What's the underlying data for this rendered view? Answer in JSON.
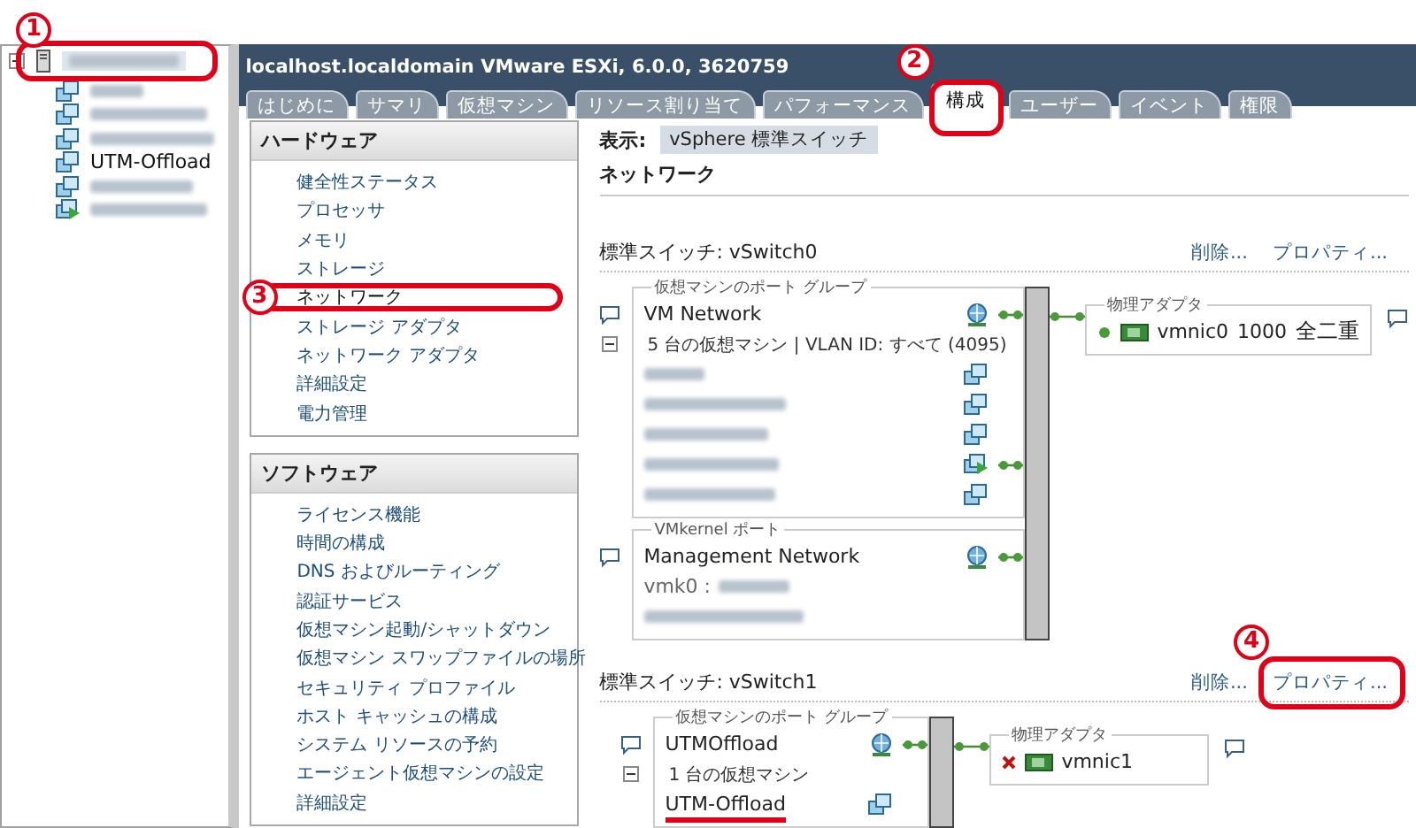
{
  "tree": {
    "host": {
      "expanded": true,
      "redacted": true,
      "step": "1"
    },
    "items": [
      {
        "kind": "vm",
        "redacted": true
      },
      {
        "kind": "vm",
        "redacted": true
      },
      {
        "kind": "vm",
        "redacted": true
      },
      {
        "kind": "vm",
        "redacted": false,
        "label": "UTM-Offload"
      },
      {
        "kind": "vm",
        "redacted": true
      },
      {
        "kind": "vm_on",
        "redacted": true
      }
    ]
  },
  "header": {
    "title": "localhost.localdomain VMware ESXi, 6.0.0, 3620759",
    "tabs": [
      {
        "label": "はじめに",
        "selected": false
      },
      {
        "label": "サマリ",
        "selected": false
      },
      {
        "label": "仮想マシン",
        "selected": false
      },
      {
        "label": "リソース割り当て",
        "selected": false
      },
      {
        "label": "パフォーマンス",
        "selected": false
      },
      {
        "label": "構成",
        "selected": true,
        "step": "2"
      },
      {
        "label": "ユーザー",
        "selected": false
      },
      {
        "label": "イベント",
        "selected": false
      },
      {
        "label": "権限",
        "selected": false
      }
    ]
  },
  "menu": [
    {
      "title": "ハードウェア",
      "items": [
        {
          "label": "健全性ステータス",
          "selected": false
        },
        {
          "label": "プロセッサ",
          "selected": false
        },
        {
          "label": "メモリ",
          "selected": false
        },
        {
          "label": "ストレージ",
          "selected": false
        },
        {
          "label": "ネットワーク",
          "selected": true,
          "step": "3"
        },
        {
          "label": "ストレージ アダプタ",
          "selected": false
        },
        {
          "label": "ネットワーク アダプタ",
          "selected": false
        },
        {
          "label": "詳細設定",
          "selected": false
        },
        {
          "label": "電力管理",
          "selected": false
        }
      ]
    },
    {
      "title": "ソフトウェア",
      "items": [
        {
          "label": "ライセンス機能",
          "selected": false
        },
        {
          "label": "時間の構成",
          "selected": false
        },
        {
          "label": "DNS およびルーティング",
          "selected": false
        },
        {
          "label": "認証サービス",
          "selected": false
        },
        {
          "label": "仮想マシン起動/シャットダウン",
          "selected": false
        },
        {
          "label": "仮想マシン スワップファイルの場所",
          "selected": false
        },
        {
          "label": "セキュリティ プロファイル",
          "selected": false
        },
        {
          "label": "ホスト キャッシュの構成",
          "selected": false
        },
        {
          "label": "システム リソースの予約",
          "selected": false
        },
        {
          "label": "エージェント仮想マシンの設定",
          "selected": false
        },
        {
          "label": "詳細設定",
          "selected": false
        }
      ]
    }
  ],
  "view": {
    "label": "表示:",
    "value": "vSphere 標準スイッチ"
  },
  "heading": "ネットワーク",
  "switches": [
    {
      "label": "標準スイッチ: vSwitch0",
      "actions": [
        {
          "label": "削除..."
        },
        {
          "label": "プロパティ..."
        }
      ],
      "groups": [
        {
          "kind": "vm_portgroup",
          "legend": "仮想マシンのポート グループ",
          "name": "VM Network",
          "summary": "5 台の仮想マシン | VLAN ID: すべて (4095)",
          "expanded": true,
          "vms": [
            {
              "kind": "vm",
              "redacted": true
            },
            {
              "kind": "vm",
              "redacted": true
            },
            {
              "kind": "vm",
              "redacted": true
            },
            {
              "kind": "vm_on",
              "redacted": true
            },
            {
              "kind": "vm",
              "redacted": true
            }
          ]
        },
        {
          "kind": "vmkernel",
          "legend": "VMkernel ポート",
          "name": "Management Network",
          "details": [
            {
              "label": "vmk0 :",
              "redacted": true
            },
            {
              "redacted": true
            }
          ]
        }
      ],
      "adapter": {
        "legend": "物理アダプタ",
        "name": "vmnic0",
        "speed": "1000",
        "duplex": "全二重",
        "connected": true
      }
    },
    {
      "label": "標準スイッチ: vSwitch1",
      "actions": [
        {
          "label": "削除..."
        },
        {
          "label": "プロパティ...",
          "step": "4"
        }
      ],
      "groups": [
        {
          "kind": "vm_portgroup",
          "legend": "仮想マシンのポート グループ",
          "name": "UTMOffload",
          "summary": "1 台の仮想マシン",
          "expanded": true,
          "vms": [
            {
              "kind": "vm",
              "redacted": false,
              "label": "UTM-Offload",
              "underlined": true
            }
          ]
        }
      ],
      "adapter": {
        "legend": "物理アダプタ",
        "name": "vmnic1",
        "connected": false
      }
    }
  ]
}
